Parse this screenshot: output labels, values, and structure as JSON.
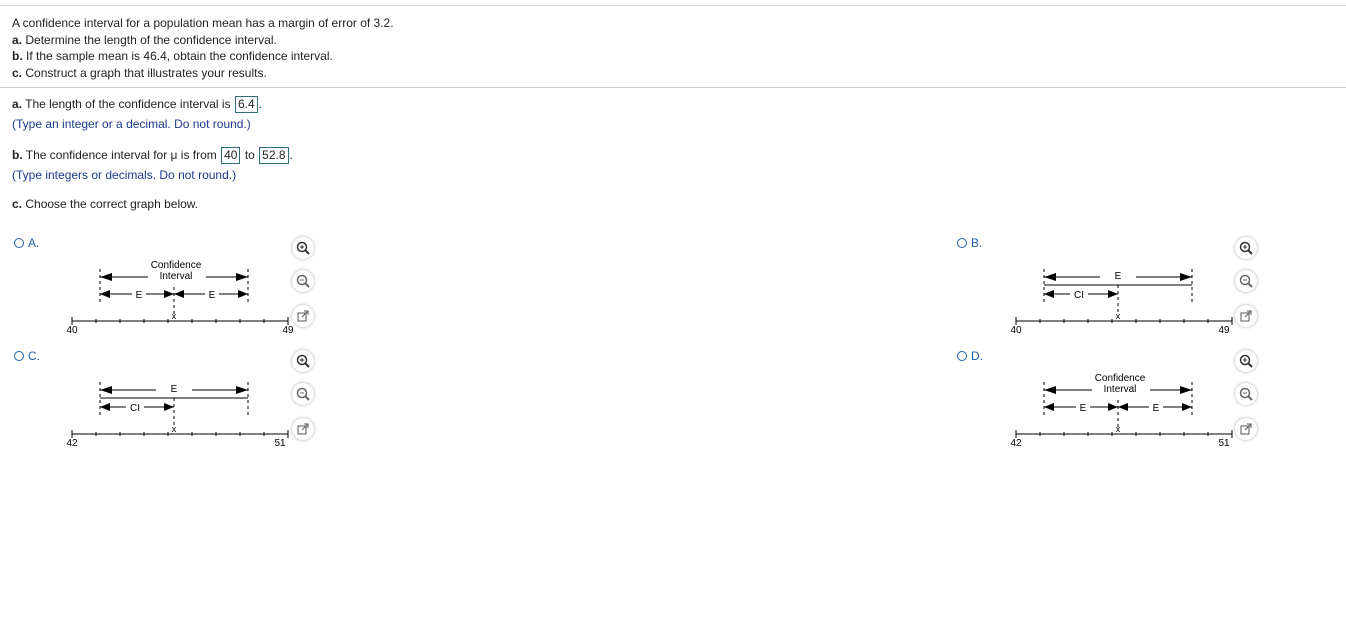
{
  "question": {
    "intro": "A confidence interval for a population mean has a margin of error of 3.2.",
    "a_prefix": "a.",
    "a_text": " Determine the length of the confidence interval.",
    "b_prefix": "b.",
    "b_text": " If the sample mean is 46.4, obtain the confidence interval.",
    "c_prefix": "c.",
    "c_text": " Construct a graph that illustrates your results."
  },
  "part_a": {
    "prefix": "a.",
    "text": " The length of the confidence interval is ",
    "answer": "6.4",
    "end": ".",
    "hint": "(Type an integer or a decimal. Do not round.)"
  },
  "part_b": {
    "prefix": "b.",
    "text": " The confidence interval for μ is from ",
    "answer_low": "40",
    "to": " to ",
    "answer_high": "52.8",
    "end": ".",
    "hint": "(Type integers or decimals. Do not round.)"
  },
  "part_c": {
    "prefix": "c.",
    "text": " Choose the correct graph below."
  },
  "options": [
    {
      "label": "A.",
      "type": "ci",
      "axis_min": "40",
      "axis_max": "49",
      "ci_label_1": "Confidence",
      "ci_label_2": "Interval",
      "e_label": "E",
      "x_label": "x"
    },
    {
      "label": "B.",
      "type": "swapped",
      "axis_min": "40",
      "axis_max": "49",
      "e_label": "E",
      "ci_label": "CI",
      "x_label": "x"
    },
    {
      "label": "C.",
      "type": "swapped",
      "axis_min": "42",
      "axis_max": "51",
      "e_label": "E",
      "ci_label": "CI",
      "x_label": "x"
    },
    {
      "label": "D.",
      "type": "ci",
      "axis_min": "42",
      "axis_max": "51",
      "ci_label_1": "Confidence",
      "ci_label_2": "Interval",
      "e_label": "E",
      "x_label": "x"
    }
  ],
  "icons": {
    "zoom_in": "zoom-in-icon",
    "zoom_out": "zoom-out-icon",
    "popout": "popout-icon"
  }
}
